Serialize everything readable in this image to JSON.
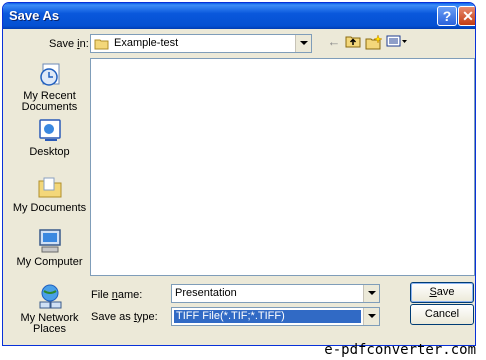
{
  "window": {
    "title": "Save As"
  },
  "save_in": {
    "label_pre": "Save ",
    "label_u": "i",
    "label_post": "n:",
    "value": "Example-test"
  },
  "toolbar": {
    "icons": [
      "back-arrow-icon",
      "up-folder-icon",
      "new-folder-icon",
      "views-menu-icon"
    ]
  },
  "places": [
    {
      "label": "My Recent Documents",
      "icon": "recent-documents-icon"
    },
    {
      "label": "Desktop",
      "icon": "desktop-icon"
    },
    {
      "label": "My Documents",
      "icon": "my-documents-icon"
    },
    {
      "label": "My Computer",
      "icon": "my-computer-icon"
    },
    {
      "label": "My Network Places",
      "icon": "network-places-icon"
    }
  ],
  "file_name": {
    "label_pre": "File ",
    "label_u": "n",
    "label_post": "ame:",
    "value": "Presentation"
  },
  "save_as_type": {
    "label_pre": "Save as ",
    "label_u": "t",
    "label_post": "ype:",
    "value": "TIFF File(*.TIF;*.TIFF)"
  },
  "buttons": {
    "save_u": "S",
    "save_rest": "ave",
    "cancel": "Cancel"
  },
  "watermark": "e-pdfconverter.com"
}
